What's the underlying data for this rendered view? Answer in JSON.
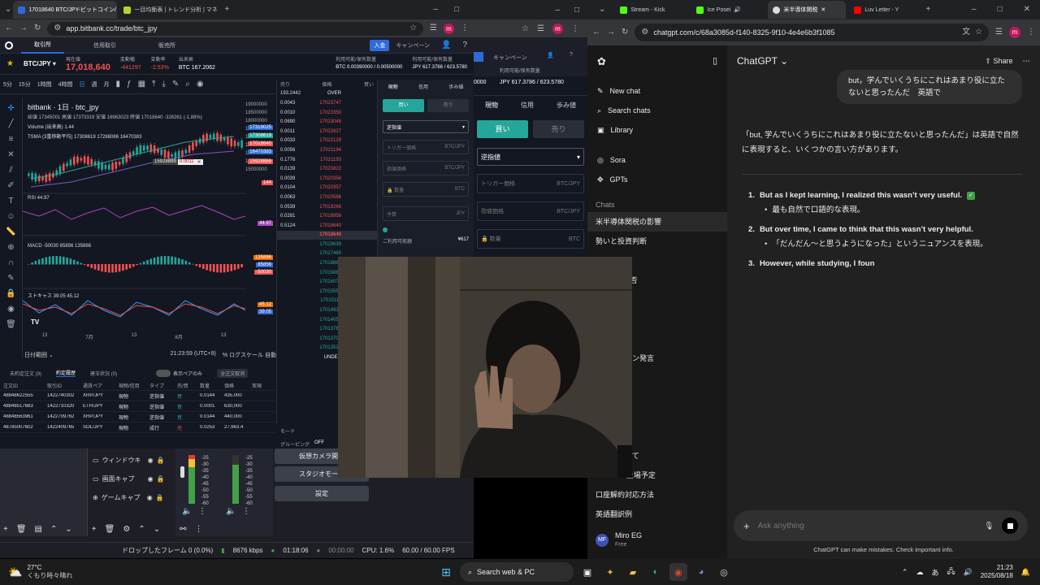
{
  "left_browser": {
    "tabs": [
      "17018640 BTC/JPY-ビットコイン/日",
      "一目均衡表 | トレンド分析 | マネ"
    ],
    "url": "app.bitbank.cc/trade/btc_jpy",
    "avatar_letter": "m",
    "nav_tabs": [
      "取引所",
      "信用取引",
      "販売所"
    ],
    "deposit": "入金",
    "campaign": "キャンペーン",
    "pair": "BTC/JPY",
    "price_label": "現在値",
    "price": "17,018,640",
    "change_label": "変動幅",
    "change": "-441297",
    "rate_label": "変動率",
    "rate": "-2.53%",
    "volume_label": "出来高",
    "volume": "BTC 167.2062",
    "available_label": "利用可能/保有数量",
    "btc_avail": "BTC 0.00390000 / 0.00500000",
    "jpy_avail": "JPY 617.3786 / 623.5780",
    "timeframes": [
      "5分",
      "15分",
      "1時間",
      "4時間",
      "日",
      "週",
      "月"
    ],
    "chart_title": "bitbank · 1日 · btc_jpy",
    "ohlc": "始値 17345001 高値 17373319 安値 16963023 終値 17018640 -326361 (-1.88%)",
    "volume_indicator": "Volume (出来高) 1.44",
    "tsma": "TSMA (3重移動平均) 17308619 17288086 16470383",
    "rsi_label": "RSI 44.97",
    "macd_label": "MACD -50030 85856 135886",
    "stoch_label": "ストキャス 39.05 45.12",
    "price_axis": [
      "19000000",
      "18500000",
      "18000000",
      "17500000",
      "17000000",
      "16500000",
      "16000000",
      "15500000",
      "15000000"
    ],
    "price_tags": [
      "17319025",
      "17308619",
      "17018640",
      "16470383",
      "15928889",
      "144"
    ],
    "rsi_tag": "44.97",
    "macd_tags": [
      "135886",
      "85856",
      "-50030"
    ],
    "macd_axis": [
      "500000",
      "-500000"
    ],
    "stoch_tags": [
      "45.12",
      "39.05"
    ],
    "x_axis": [
      "13",
      "7月",
      "13",
      "8月",
      "13"
    ],
    "date_range": "日付範囲",
    "clock": "21:23:59 (UTC+9)",
    "log_scale": "% ログスケール 自動",
    "crosshair_price": "15928889",
    "crosshair_qty": "0.0011",
    "orderbook_headers": [
      "売り",
      "価格",
      "買い"
    ],
    "orderbook_top": [
      "193.2442",
      "OVER"
    ],
    "asks": [
      [
        "0.0043",
        "17023747"
      ],
      [
        "0.0010",
        "17023350"
      ],
      [
        "0.0690",
        "17023046"
      ],
      [
        "0.0011",
        "17022627"
      ],
      [
        "0.0033",
        "17022129"
      ],
      [
        "0.0056",
        "17021194"
      ],
      [
        "0.1776",
        "17021193"
      ],
      [
        "0.0139",
        "17020822"
      ],
      [
        "0.0039",
        "17020358"
      ],
      [
        "0.0104",
        "17020357"
      ],
      [
        "0.0063",
        "17020586"
      ],
      [
        "0.0539",
        "17019266"
      ],
      [
        "0.0281",
        "17018958"
      ],
      [
        "0.5124",
        "17018640"
      ]
    ],
    "mid_price": "17018640",
    "bids": [
      "17018639",
      "17017465",
      "17016889",
      "17016888",
      "17016079",
      "17015552",
      "17015111",
      "17014935",
      "17014050",
      "17013760",
      "17013700",
      "17013525"
    ],
    "orderbook_bottom": "UNDER",
    "order_tabs": [
      "現物",
      "信用",
      "歩み値"
    ],
    "buy": "買い",
    "sell": "売り",
    "order_type": "逆指値",
    "trigger_label": "トリガー価格",
    "limit_label": "指値価格",
    "qty_label": "数量",
    "pair_unit": "BTC/JPY",
    "btc_unit": "BTC",
    "jpy_unit": "JPY",
    "budget_label": "予算",
    "available_amount_label": "ご利用可能額",
    "available_amount": "¥617",
    "history_tabs": [
      "未約定注文 (9)",
      "約定履歴",
      "建玉状況 (0)"
    ],
    "history_toggle": "表示ペアのみ",
    "bulk_cancel": "全注文取消",
    "history_headers": [
      "注文ID",
      "取引ID",
      "通貨ペア",
      "現物/信用",
      "タイプ",
      "売/買",
      "数量",
      "価格",
      "実現"
    ],
    "history_rows": [
      [
        "48848622555",
        "1422740302",
        "XRP/JPY",
        "現物",
        "逆指値",
        "買",
        "0.0144",
        "435.000"
      ],
      [
        "48848517683",
        "1422710320",
        "ETH/JPY",
        "現物",
        "逆指値",
        "買",
        "0.0001",
        "630,000"
      ],
      [
        "48848563961",
        "1422709762",
        "XRP/JPY",
        "現物",
        "逆指値",
        "買",
        "0.0144",
        "440.000"
      ],
      [
        "48785007602",
        "1422409765",
        "SOL/JPY",
        "現物",
        "成行",
        "売",
        "0.0253",
        "27,663.4"
      ]
    ],
    "mode_label": "モード",
    "grouping": "グルーピング",
    "grouping_val": "OFF"
  },
  "obs": {
    "sources": [
      "ウィンドウキ",
      "画面キャプ",
      "ゲームキャプ"
    ],
    "meter_labels": [
      "-25",
      "-30",
      "-35",
      "-40",
      "-45",
      "-50",
      "-55",
      "-60"
    ],
    "buttons": [
      "仮想カメラ開始",
      "スタジオモード",
      "設定"
    ],
    "status": {
      "dropped": "ドロップしたフレーム 0 (0.0%)",
      "bitrate": "8676 kbps",
      "rec_time": "01:18:06",
      "stream_time": "00:00:00",
      "cpu": "CPU: 1.6%",
      "fps": "60.00 / 60.00 FPS"
    }
  },
  "mid_browser": {
    "campaign": "キャンペーン",
    "avatar_letter": "m",
    "available_label": "利用可能/保有数量",
    "btc_avail": "0000",
    "jpy_avail": "JPY 617.3786 / 623.5780",
    "order_tabs": [
      "現物",
      "信用",
      "歩み値"
    ],
    "buy": "買い",
    "sell": "売り",
    "order_type": "逆指値",
    "trigger_label": "トリガー価格",
    "limit_label": "指値価格",
    "qty_label": "数量",
    "pair_unit": "BTC/JPY",
    "btc_unit": "BTC"
  },
  "right_browser": {
    "tabs": [
      "Stream - Kick",
      "Ice Posei",
      "米半導体関税",
      "Luv Letter - Y"
    ],
    "url": "chatgpt.com/c/68a3085d-f140-8325-9f10-4e4e6b3f1085",
    "avatar_letter": "m",
    "app_title": "ChatGPT",
    "share": "Share",
    "sidebar_actions": [
      "New chat",
      "Search chats",
      "Library"
    ],
    "sidebar_apps": [
      "Sora",
      "GPTs"
    ],
    "chats_heading": "Chats",
    "chats": [
      "米半導体関税の影響",
      "勢いと投資判断",
      "資結果",
      "ix配信の可否",
      "ドバイス",
      "リ方",
      "済方法",
      "ビットコイン発言",
      "J 英語",
      "方法",
      "金化方法",
      "イズの基本",
      "上限について",
      "XRP ETF上場予定",
      "口座解約対応方法",
      "英語翻訳例"
    ],
    "user_name": "Miro EG",
    "user_plan": "Free",
    "user_initials": "MF",
    "user_message": "but，学んでいくうちにこれはあまり役に立たないと思ったんだ　英語で",
    "assistant_intro": "「but, 学んでいくうちにこれはあまり役に立たないと思ったんだ」は英語で自然に表現すると、いくつかの言い方があります。",
    "answers": [
      {
        "num": "1.",
        "text": "But as I kept learning, I realized this wasn’t very useful.",
        "note": "最も自然で口語的な表現。"
      },
      {
        "num": "2.",
        "text": "But over time, I came to think that this wasn’t very helpful.",
        "note": "「だんだん〜と思うようになった」というニュアンスを表現。"
      },
      {
        "num": "3.",
        "text": "However, while studying, I foun",
        "note": ""
      }
    ],
    "input_placeholder": "Ask anything",
    "disclaimer": "ChatGPT can make mistakes. Check important info."
  },
  "taskbar": {
    "temp": "27°C",
    "weather": "くもり時々晴れ",
    "search": "Search web & PC",
    "ime": "あ",
    "time": "21:23",
    "date": "2025/08/18"
  }
}
